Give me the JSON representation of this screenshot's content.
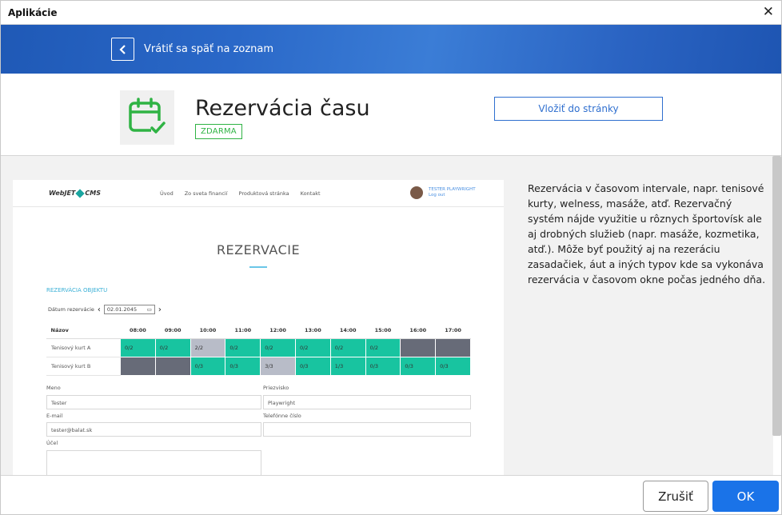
{
  "window": {
    "title": "Aplikácie"
  },
  "header": {
    "back_label": "Vrátiť sa späť na zoznam"
  },
  "app": {
    "title": "Rezervácia času",
    "badge": "ZDARMA",
    "insert_button": "Vložiť do stránky"
  },
  "preview": {
    "logo_left": "WebJET",
    "logo_right": "CMS",
    "menu": [
      "Úvod",
      "Zo sveta financií",
      "Produktová stránka",
      "Kontakt"
    ],
    "user_name": "TESTER PLAYWRIGHT",
    "user_logout": "Log out",
    "heading": "REZERVACIE",
    "section_label": "REZERVÁCIA OBJEKTU",
    "date_label": "Dátum rezervácie",
    "date_value": "02.01.2045",
    "table": {
      "header_first": "Názov",
      "times": [
        "08:00",
        "09:00",
        "10:00",
        "11:00",
        "12:00",
        "13:00",
        "14:00",
        "15:00",
        "16:00",
        "17:00"
      ],
      "rows": [
        {
          "name": "Tenisový kurt A",
          "cells": [
            {
              "text": "0/2",
              "state": "free"
            },
            {
              "text": "0/2",
              "state": "free"
            },
            {
              "text": "2/2",
              "state": "part"
            },
            {
              "text": "0/2",
              "state": "free"
            },
            {
              "text": "0/2",
              "state": "free"
            },
            {
              "text": "0/2",
              "state": "free"
            },
            {
              "text": "0/2",
              "state": "free"
            },
            {
              "text": "0/2",
              "state": "free"
            },
            {
              "text": "",
              "state": "full"
            },
            {
              "text": "",
              "state": "full"
            }
          ]
        },
        {
          "name": "Tenisový kurt B",
          "cells": [
            {
              "text": "",
              "state": "full"
            },
            {
              "text": "",
              "state": "full"
            },
            {
              "text": "0/3",
              "state": "free"
            },
            {
              "text": "0/3",
              "state": "free"
            },
            {
              "text": "3/3",
              "state": "part"
            },
            {
              "text": "0/3",
              "state": "free"
            },
            {
              "text": "1/3",
              "state": "free"
            },
            {
              "text": "0/3",
              "state": "free"
            },
            {
              "text": "0/3",
              "state": "free"
            },
            {
              "text": "0/3",
              "state": "free"
            }
          ]
        }
      ]
    },
    "form": {
      "name_label": "Meno",
      "name_value": "Tester",
      "surname_label": "Priezvisko",
      "surname_value": "Playwright",
      "email_label": "E-mail",
      "email_value": "tester@balat.sk",
      "phone_label": "Telefónne číslo",
      "phone_value": "",
      "purpose_label": "Účel"
    }
  },
  "description": "Rezervácia v časovom intervale, napr. tenisové kurty, welness, masáže, atď. Rezervačný systém nájde využitie u rôznych športovísk ale aj drobných služieb (napr. masáže, kozmetika, atď.). Môže byť použitý aj na rezeráciu zasadačiek, áut a iných typov kde sa vykonáva rezervácia v časovom okne počas jedného dňa.",
  "footer": {
    "cancel_label": "Zrušiť",
    "ok_label": "OK"
  },
  "colors": {
    "accent": "#1a73e8",
    "banner": "#2a68c8",
    "badge_green": "#2fb344",
    "slot_free": "#18c4a0",
    "slot_taken": "#b8bcc8",
    "slot_blocked": "#676b78"
  }
}
